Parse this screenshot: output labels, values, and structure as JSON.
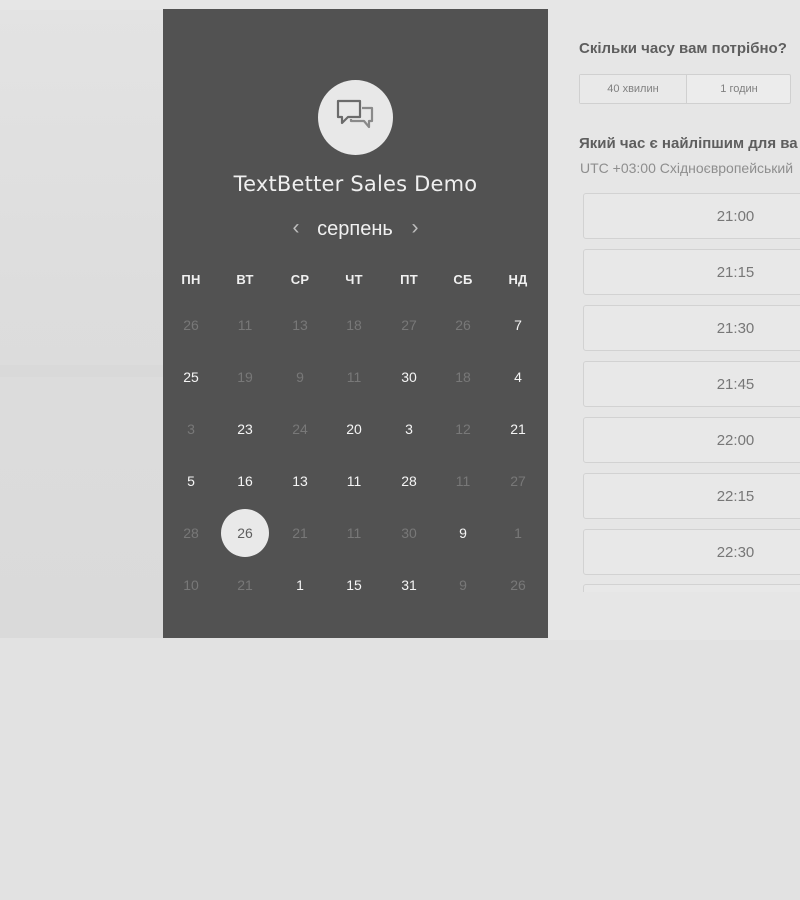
{
  "calendar": {
    "title": "TextBetter Sales Demo",
    "month": "серпень",
    "prev_icon": "chevron-left-icon",
    "next_icon": "chevron-right-icon",
    "weekdays": [
      "ПН",
      "ВТ",
      "СР",
      "ЧТ",
      "ПТ",
      "СБ",
      "НД"
    ],
    "days": [
      [
        "26",
        "11",
        "13",
        "18",
        "27",
        "26",
        "7"
      ],
      [
        "25",
        "19",
        "9",
        "11",
        "30",
        "18",
        "4"
      ],
      [
        "3",
        "23",
        "24",
        "20",
        "3",
        "12",
        "21"
      ],
      [
        "5",
        "16",
        "13",
        "11",
        "28",
        "11",
        "27"
      ],
      [
        "28",
        "26",
        "21",
        "11",
        "30",
        "9",
        "1"
      ],
      [
        "10",
        "21",
        "1",
        "15",
        "31",
        "9",
        "26"
      ]
    ],
    "selected_day": "26"
  },
  "scheduler": {
    "duration_question": "Скільки часу вам потрібно?",
    "duration_options": [
      "40 хвилин",
      "1 годин"
    ],
    "time_question": "Який час є найліпшим для ва",
    "timezone": "UTC +03:00 Східноєвропейський",
    "time_slots": [
      "21:00",
      "21:15",
      "21:30",
      "21:45",
      "22:00",
      "22:15",
      "22:30"
    ]
  },
  "icons": {
    "avatar": "chat-bubbles-icon"
  },
  "colors": {
    "panel": "#525252",
    "selected_day": "#e9e9e9",
    "available_day": "#f5f5f5",
    "unavailable_day": "#787878"
  }
}
